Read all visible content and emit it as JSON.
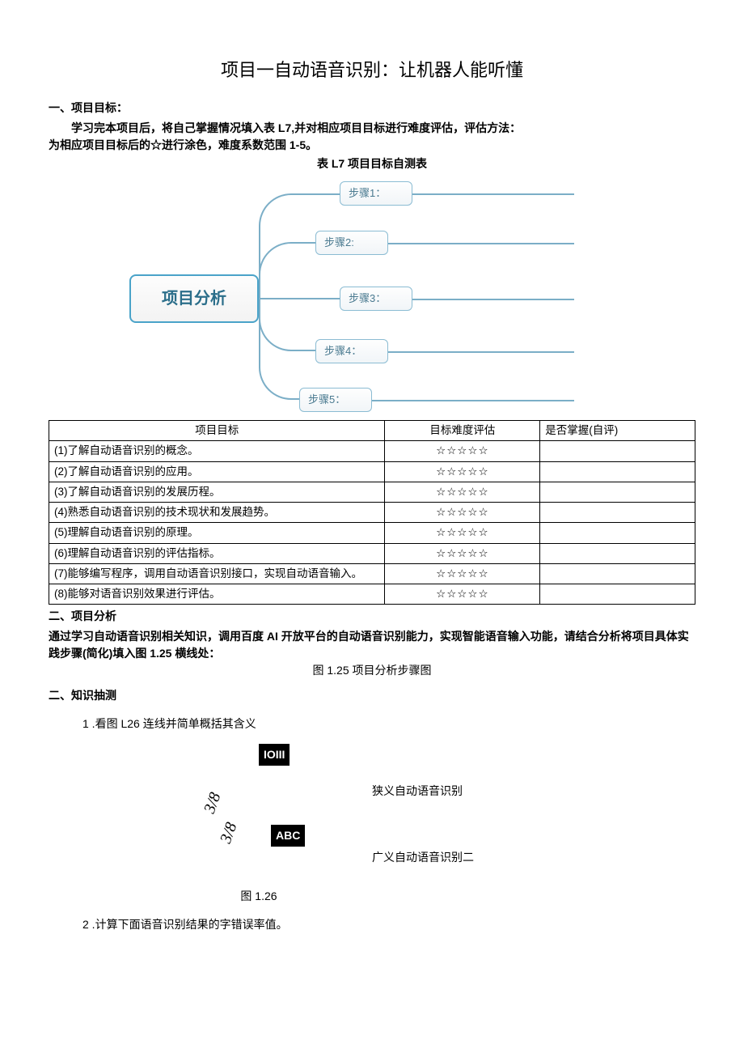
{
  "title": "项目一自动语音识别：让机器人能听懂",
  "section1": {
    "head": "一、项目目标：",
    "p1": "学习完本项目后，将自己掌握情况填入表 L7,并对相应项目目标进行难度评估，评估方法：",
    "p2": "为相应项目目标后的☆进行涂色，难度系数范围 1-5。",
    "table_caption": "表 L7 项目目标自测表",
    "mm_root": "项目分析",
    "mm_steps": [
      "步骤1：",
      "步骤2:",
      "步骤3：",
      "步骤4：",
      "步骤5："
    ],
    "thead": {
      "c1": "项目目标",
      "c2": "目标难度评估",
      "c3": "是否掌握(自评)"
    },
    "stars": "☆☆☆☆☆",
    "rows": [
      "(1)了解自动语音识别的概念。",
      "(2)了解自动语音识别的应用。",
      "(3)了解自动语音识别的发展历程。",
      "(4)熟悉自动语音识别的技术现状和发展趋势。",
      "(5)理解自动语音识别的原理。",
      "(6)理解自动语音识别的评估指标。",
      "(7)能够编写程序，调用自动语音识别接口，实现自动语音输入。",
      "(8)能够对语音识别效果进行评估。"
    ]
  },
  "section2": {
    "head": "二、项目分析",
    "p1": "通过学习自动语音识别相关知识，调用百度 AI 开放平台的自动语音识别能力，实现智能语音输入功能，请结合分析将项目具体实践步骤(简化)填入图 1.25 横线处：",
    "fig125": "图 1.25 项目分析步骤图"
  },
  "section3": {
    "head": "二、知识抽测",
    "item1": "1 .看图 L26 连线并简单概括其含义",
    "badge1": "IOIII",
    "rot1": "3/8",
    "rot2": "3/8",
    "badge2": "ABC",
    "rlabel1": "狭义自动语音识别",
    "rlabel2": "广义自动语音识别二",
    "fig126": "图 1.26",
    "item2": "2 .计算下面语音识别结果的字错误率值。"
  }
}
